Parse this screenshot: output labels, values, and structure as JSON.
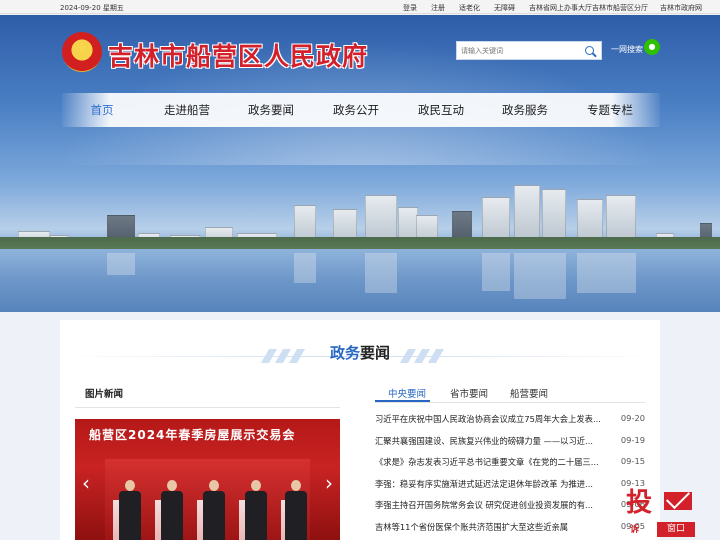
{
  "topbar": {
    "date": "2024-09-20 星期五",
    "links": [
      "登录",
      "注册",
      "适老化",
      "无障碍",
      "吉林省网上办事大厅吉林市船营区分厅"
    ],
    "gov_link": "吉林市政府网"
  },
  "header": {
    "site_title": "吉林市船营区人民政府",
    "search_placeholder": "请输入关键词",
    "yiwang_label": "一网搜索"
  },
  "nav": {
    "items": [
      {
        "label": "首页",
        "active": true
      },
      {
        "label": "走进船营"
      },
      {
        "label": "政务要闻"
      },
      {
        "label": "政务公开"
      },
      {
        "label": "政民互动"
      },
      {
        "label": "政务服务"
      },
      {
        "label": "专题专栏"
      }
    ]
  },
  "section": {
    "title_blue": "政务",
    "title_black": "要闻",
    "pic_news_title": "图片新闻",
    "photo_caption": "船营区2024年春季房屋展示交易会"
  },
  "tabs": [
    "中央要闻",
    "省市要闻",
    "船营要闻"
  ],
  "news": [
    {
      "title": "习近平在庆祝中国人民政治协商会议成立75周年大会上发表...",
      "date": "09-20"
    },
    {
      "title": "汇聚共襄强国建设、民族复兴伟业的磅礴力量 ——以习近...",
      "date": "09-19"
    },
    {
      "title": "《求是》杂志发表习近平总书记重要文章《在党的二十届三...",
      "date": "09-15"
    },
    {
      "title": "李强：稳妥有序实施渐进式延迟法定退休年龄改革 为推进...",
      "date": "09-13"
    },
    {
      "title": "李强主持召开国务院常务会议 研究促进创业投资发展的有...",
      "date": "09-06"
    },
    {
      "title": "吉林等11个省份医保个账共济范围扩大至这些近亲属",
      "date": "09-05"
    }
  ],
  "complaint": {
    "big": "投",
    "small": "诉",
    "window_label": "窗口"
  },
  "colors": {
    "brand_red": "#d3212b",
    "accent_blue": "#2767c3"
  }
}
